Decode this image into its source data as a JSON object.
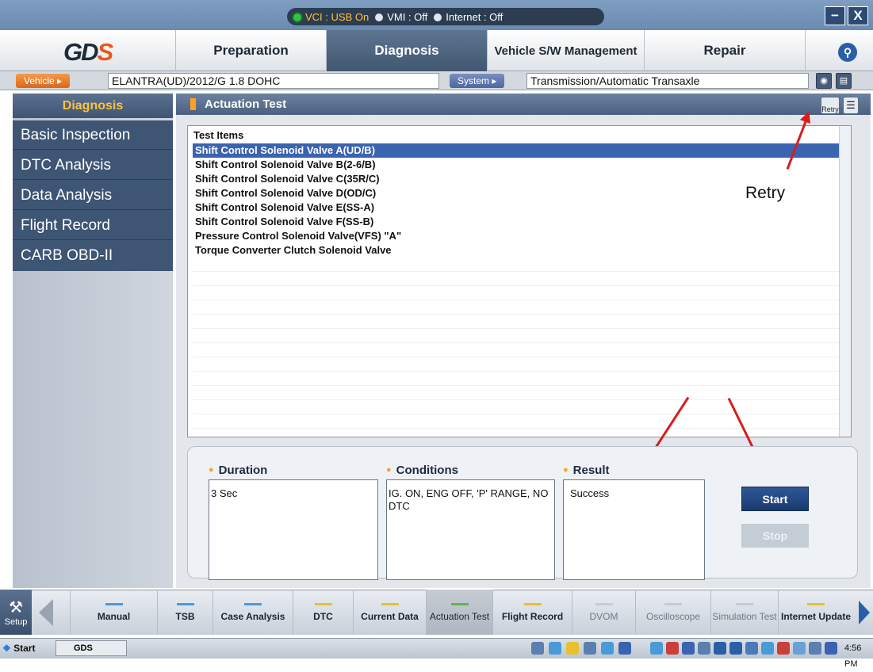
{
  "status": {
    "vci": "VCI : USB On",
    "vmi": "VMI : Off",
    "internet": "Internet : Off"
  },
  "window": {
    "min": "−",
    "close": "X"
  },
  "logo": {
    "text": "GD",
    "s": "S"
  },
  "menu": {
    "preparation": "Preparation",
    "diagnosis": "Diagnosis",
    "vehicle_sw": "Vehicle S/W Management",
    "repair": "Repair"
  },
  "vehiclebar": {
    "vehicle_label": "Vehicle ▸",
    "vehicle_value": "ELANTRA(UD)/2012/G 1.8 DOHC",
    "system_label": "System ▸",
    "system_value": "Transmission/Automatic Transaxle"
  },
  "sidebar": {
    "title": "Diagnosis",
    "items": [
      "Basic Inspection",
      "DTC Analysis",
      "Data Analysis",
      "Flight Record",
      "CARB OBD-II"
    ]
  },
  "panel": {
    "title": "Actuation Test",
    "retry_icon": "Retry"
  },
  "table": {
    "header": "Test Items",
    "rows": [
      "Shift Control Solenoid Valve A(UD/B)",
      "Shift Control Solenoid Valve B(2-6/B)",
      "Shift Control Solenoid Valve C(35R/C)",
      "Shift Control Solenoid Valve D(OD/C)",
      "Shift Control Solenoid Valve E(SS-A)",
      "Shift Control Solenoid Valve F(SS-B)",
      "Pressure Control Solenoid Valve(VFS) \"A\"",
      "Torque Converter Clutch Solenoid Valve"
    ]
  },
  "annotation": {
    "retry": "Retry"
  },
  "info": {
    "duration_label": "Duration",
    "duration_value": "3 Sec",
    "conditions_label": "Conditions",
    "conditions_value": "IG. ON, ENG OFF, 'P' RANGE, NO DTC",
    "result_label": "Result",
    "result_value": "Success",
    "start": "Start",
    "stop": "Stop"
  },
  "toolbar": {
    "setup": "Setup",
    "items": [
      {
        "label": "Manual",
        "color": "#4a9ad8"
      },
      {
        "label": "TSB",
        "color": "#4a9ad8"
      },
      {
        "label": "Case Analysis",
        "color": "#4a9ad8"
      },
      {
        "label": "DTC",
        "color": "#e8c030"
      },
      {
        "label": "Current Data",
        "color": "#e8c030"
      },
      {
        "label": "Actuation Test",
        "color": "#5cb848"
      },
      {
        "label": "Flight Record",
        "color": "#e8c030"
      },
      {
        "label": "DVOM",
        "color": "#c8ccd2"
      },
      {
        "label": "Oscilloscope",
        "color": "#c8ccd2"
      },
      {
        "label": "Simulation Test",
        "color": "#c8ccd2"
      },
      {
        "label": "Internet Update",
        "color": "#e8c030"
      }
    ]
  },
  "taskbar": {
    "start": "Start",
    "task": "GDS",
    "clock": "4:56 PM"
  }
}
